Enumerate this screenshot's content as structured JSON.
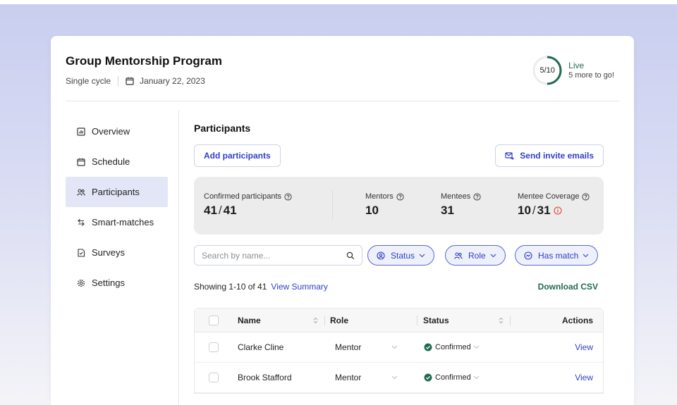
{
  "program": {
    "title": "Group Mentorship Program",
    "cycle": "Single cycle",
    "date": "January 22, 2023"
  },
  "progress": {
    "label": "5/10",
    "value": 5,
    "total": 10,
    "status": "Live",
    "sub": "5 more to go!"
  },
  "sidebar": {
    "items": [
      {
        "label": "Overview",
        "icon": "chart-icon"
      },
      {
        "label": "Schedule",
        "icon": "calendar-icon"
      },
      {
        "label": "Participants",
        "icon": "users-icon"
      },
      {
        "label": "Smart-matches",
        "icon": "swap-icon"
      },
      {
        "label": "Surveys",
        "icon": "survey-icon"
      },
      {
        "label": "Settings",
        "icon": "gear-icon"
      }
    ],
    "active": "Participants"
  },
  "participants": {
    "title": "Participants",
    "add_label": "Add participants",
    "invite_label": "Send invite emails"
  },
  "stats": {
    "confirmed_label": "Confirmed participants",
    "confirmed": "41",
    "confirmed_total": "41",
    "mentors_label": "Mentors",
    "mentors": "10",
    "mentees_label": "Mentees",
    "mentees": "31",
    "coverage_label": "Mentee Coverage",
    "coverage": "10",
    "coverage_total": "31"
  },
  "filters": {
    "search_placeholder": "Search by name...",
    "status": "Status",
    "role": "Role",
    "has_match": "Has match"
  },
  "summary": {
    "showing": "Showing 1-10 of 41",
    "view_summary": "View Summary",
    "download": "Download CSV"
  },
  "table": {
    "headers": {
      "name": "Name",
      "role": "Role",
      "status": "Status",
      "actions": "Actions"
    },
    "rows": [
      {
        "name": "Clarke Cline",
        "role": "Mentor",
        "status": "Confirmed",
        "action": "View"
      },
      {
        "name": "Brook Stafford",
        "role": "Mentor",
        "status": "Confirmed",
        "action": "View"
      }
    ]
  },
  "colors": {
    "accent": "#2f3fc9",
    "live_green": "#1f6b4f",
    "warning_red": "#e0433a",
    "active_bg": "#e3e6f7"
  }
}
